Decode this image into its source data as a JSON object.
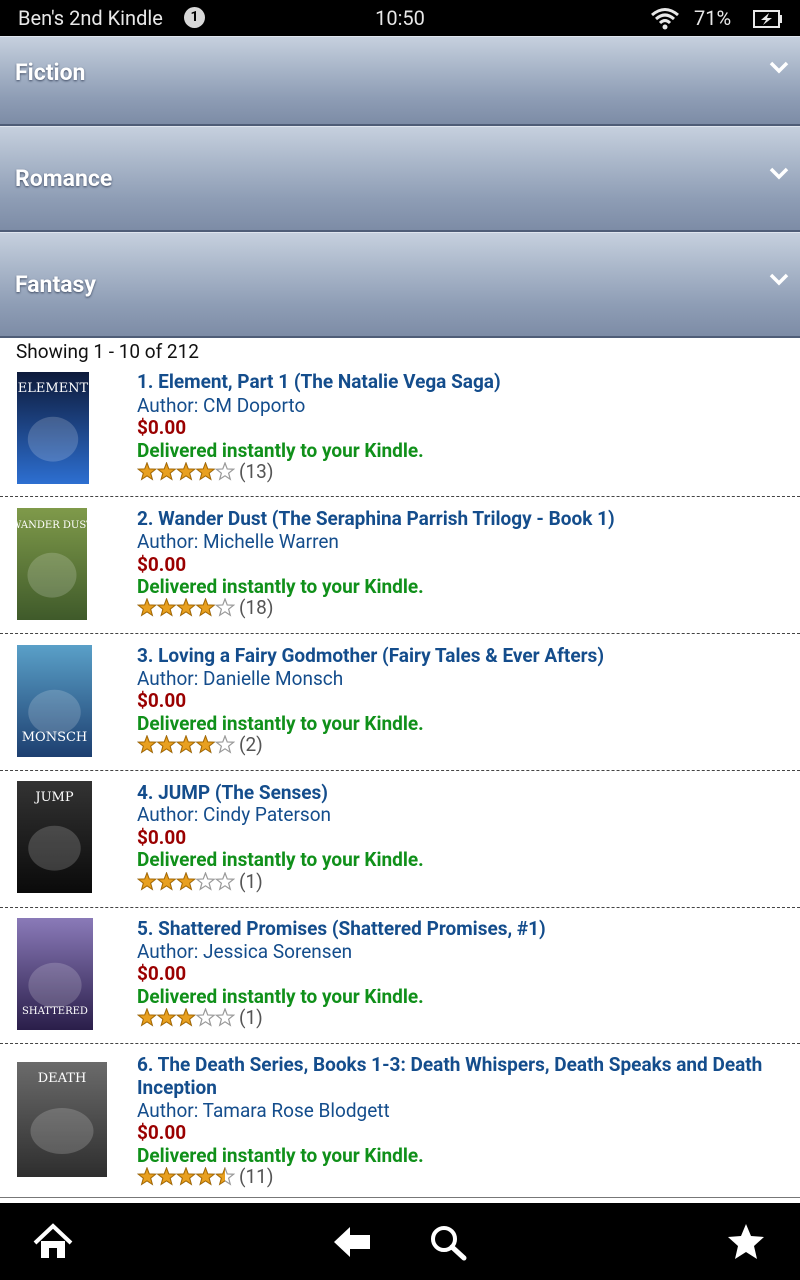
{
  "status_bar": {
    "device_name": "Ben's 2nd Kindle",
    "notification_count": "1",
    "time": "10:50",
    "battery_percent": "71%"
  },
  "categories": [
    {
      "label": "Fiction"
    },
    {
      "label": "Romance"
    },
    {
      "label": "Fantasy"
    }
  ],
  "results_summary": "Showing 1 - 10 of 212",
  "books": [
    {
      "title": "1. Element, Part 1 (The Natalie Vega Saga)",
      "author": "Author: CM Doporto",
      "price": "$0.00",
      "delivery": "Delivered instantly to your Kindle.",
      "stars": 4,
      "review_count": "(13)",
      "cover_text": "ELEMENT",
      "cover_colors": [
        "#0d1a3a",
        "#2d6fd1"
      ]
    },
    {
      "title": "2. Wander Dust (The Seraphina Parrish Trilogy - Book 1)",
      "author": "Author: Michelle Warren",
      "price": "$0.00",
      "delivery": "Delivered instantly to your Kindle.",
      "stars": 4,
      "review_count": "(18)",
      "cover_text": "WANDER DUST",
      "cover_colors": [
        "#7f9a4a",
        "#3f5a2a"
      ]
    },
    {
      "title": "3. Loving a Fairy Godmother (Fairy Tales & Ever Afters)",
      "author": "Author: Danielle Monsch",
      "price": "$0.00",
      "delivery": "Delivered instantly to your Kindle.",
      "stars": 4,
      "review_count": "(2)",
      "cover_text": "MONSCH",
      "cover_colors": [
        "#5aa0c8",
        "#1d3f70"
      ]
    },
    {
      "title": "4. JUMP (The Senses)",
      "author": "Author: Cindy Paterson",
      "price": "$0.00",
      "delivery": "Delivered instantly to your Kindle.",
      "stars": 3,
      "review_count": "(1)",
      "cover_text": "JUMP",
      "cover_colors": [
        "#333333",
        "#0a0a0a"
      ]
    },
    {
      "title": "5. Shattered Promises (Shattered Promises, #1)",
      "author": "Author: Jessica Sorensen",
      "price": "$0.00",
      "delivery": "Delivered instantly to your Kindle.",
      "stars": 3,
      "review_count": "(1)",
      "cover_text": "SHATTERED",
      "cover_colors": [
        "#8a7ab8",
        "#2a1e4a"
      ]
    },
    {
      "title": "6. The Death Series, Books 1-3: Death Whispers, Death Speaks and Death Inception",
      "author": "Author: Tamara Rose Blodgett",
      "price": "$0.00",
      "delivery": "Delivered instantly to your Kindle.",
      "stars": 4.5,
      "review_count": "(11)",
      "cover_text": "DEATH",
      "cover_colors": [
        "#6b6b6b",
        "#2e2e2e"
      ]
    }
  ],
  "colors": {
    "title_blue": "#144d8c",
    "price_red": "#9a0000",
    "delivery_green": "#10901a",
    "star_gold": "#e8a020"
  }
}
